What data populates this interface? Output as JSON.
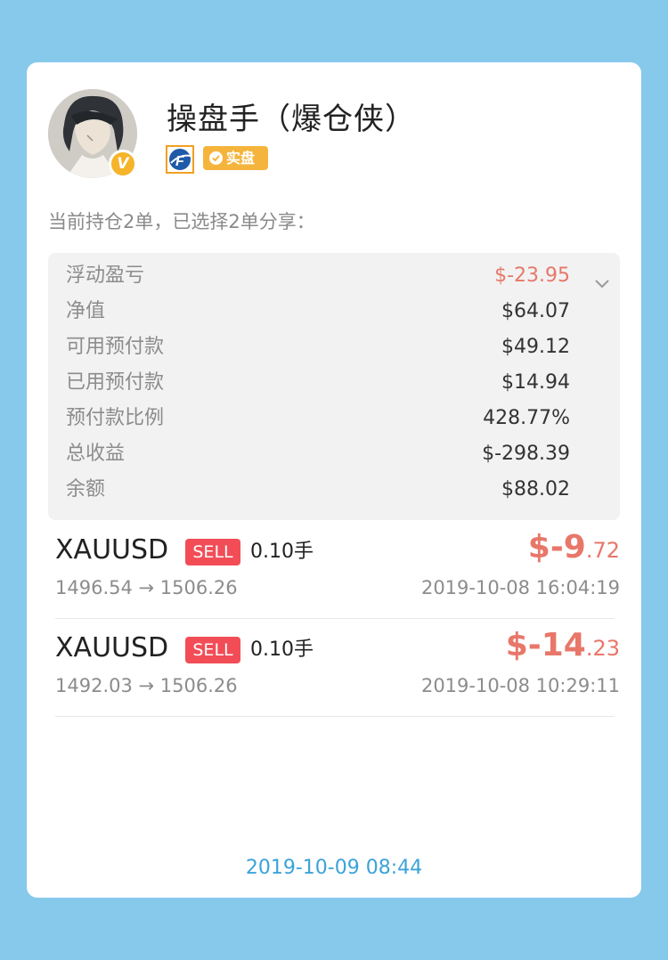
{
  "user": {
    "name": "操盘手（爆仓侠）",
    "verified_letter": "V",
    "badge_real": "实盘",
    "broker_logo_letter": "F"
  },
  "holding_note": "当前持仓2单，已选择2单分享：",
  "summary": {
    "rows": [
      {
        "label": "浮动盈亏",
        "value": "$-23.95"
      },
      {
        "label": "净值",
        "value": "$64.07"
      },
      {
        "label": "可用预付款",
        "value": "$49.12"
      },
      {
        "label": "已用预付款",
        "value": "$14.94"
      },
      {
        "label": "预付款比例",
        "value": "428.77%"
      },
      {
        "label": "总收益",
        "value": "$-298.39"
      },
      {
        "label": "余额",
        "value": "$88.02"
      }
    ]
  },
  "orders": [
    {
      "symbol": "XAUUSD",
      "side": "SELL",
      "lots": "0.10手",
      "pnl_main": "$-9",
      "pnl_decimals": ".72",
      "prices": "1496.54 → 1506.26",
      "time": "2019-10-08 16:04:19"
    },
    {
      "symbol": "XAUUSD",
      "side": "SELL",
      "lots": "0.10手",
      "pnl_main": "$-14",
      "pnl_decimals": ".23",
      "prices": "1492.03 → 1506.26",
      "time": "2019-10-08 10:29:11"
    }
  ],
  "footer_time": "2019-10-09 08:44",
  "colors": {
    "background": "#87c9eb",
    "loss": "#e8776a",
    "sell": "#f24d57",
    "badge_gold": "#f5b53c",
    "footer": "#3aa3d8"
  }
}
